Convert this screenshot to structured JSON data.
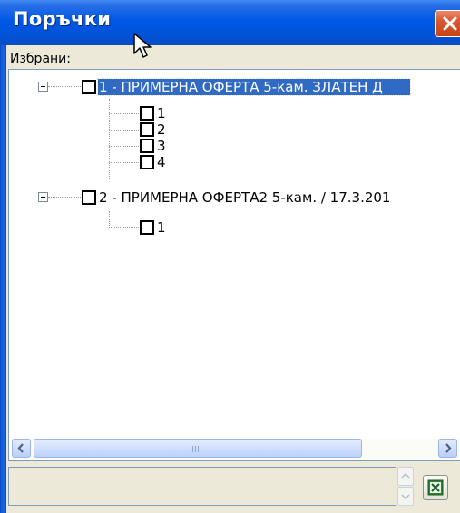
{
  "window": {
    "title": "Поръчки",
    "colors": {
      "titlebar": "#0058e6",
      "selection": "#316ac5",
      "close": "#d9572f"
    }
  },
  "panel": {
    "selected_label": "Избрани:"
  },
  "tree": {
    "nodes": [
      {
        "label": "1 - ПРИМЕРНА ОФЕРТА 5-кам. ЗЛАТЕН Д",
        "selected": true,
        "expanded": true,
        "children": [
          {
            "label": "1"
          },
          {
            "label": "2"
          },
          {
            "label": "3"
          },
          {
            "label": "4"
          }
        ]
      },
      {
        "label": "2 - ПРИМЕРНА ОФЕРТА2 5-кам. / 17.3.201",
        "selected": false,
        "expanded": true,
        "children": [
          {
            "label": "1"
          }
        ]
      }
    ]
  },
  "icons": {
    "close": "close-icon",
    "cursor": "mouse-cursor-icon",
    "scroll_left": "arrow-left-icon",
    "scroll_right": "arrow-right-icon",
    "spin_up": "arrow-up-icon",
    "spin_down": "arrow-down-icon",
    "export": "excel-icon"
  }
}
